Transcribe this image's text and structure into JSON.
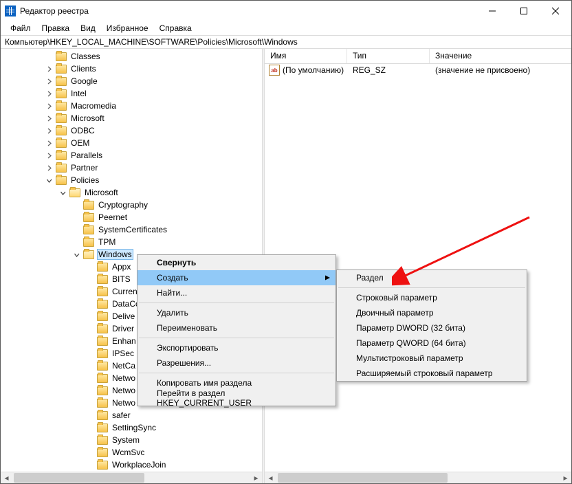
{
  "window": {
    "title": "Редактор реестра"
  },
  "menu": {
    "file": "Файл",
    "edit": "Правка",
    "view": "Вид",
    "fav": "Избранное",
    "help": "Справка"
  },
  "address": "Компьютер\\HKEY_LOCAL_MACHINE\\SOFTWARE\\Policies\\Microsoft\\Windows",
  "tree": {
    "items": [
      {
        "indent": 3,
        "expander": "",
        "label": "Classes"
      },
      {
        "indent": 3,
        "expander": "closed",
        "label": "Clients"
      },
      {
        "indent": 3,
        "expander": "closed",
        "label": "Google"
      },
      {
        "indent": 3,
        "expander": "closed",
        "label": "Intel"
      },
      {
        "indent": 3,
        "expander": "closed",
        "label": "Macromedia"
      },
      {
        "indent": 3,
        "expander": "closed",
        "label": "Microsoft"
      },
      {
        "indent": 3,
        "expander": "closed",
        "label": "ODBC"
      },
      {
        "indent": 3,
        "expander": "closed",
        "label": "OEM"
      },
      {
        "indent": 3,
        "expander": "closed",
        "label": "Parallels"
      },
      {
        "indent": 3,
        "expander": "closed",
        "label": "Partner"
      },
      {
        "indent": 3,
        "expander": "open",
        "label": "Policies"
      },
      {
        "indent": 4,
        "expander": "open",
        "label": "Microsoft",
        "open": true
      },
      {
        "indent": 5,
        "expander": "",
        "label": "Cryptography"
      },
      {
        "indent": 5,
        "expander": "",
        "label": "Peernet"
      },
      {
        "indent": 5,
        "expander": "",
        "label": "SystemCertificates"
      },
      {
        "indent": 5,
        "expander": "",
        "label": "TPM"
      },
      {
        "indent": 5,
        "expander": "open",
        "label": "Windows",
        "open": true,
        "selected": true
      },
      {
        "indent": 6,
        "expander": "",
        "label": "Appx"
      },
      {
        "indent": 6,
        "expander": "",
        "label": "BITS"
      },
      {
        "indent": 6,
        "expander": "",
        "label": "CurrentVersion"
      },
      {
        "indent": 6,
        "expander": "",
        "label": "DataCollection"
      },
      {
        "indent": 6,
        "expander": "",
        "label": "Delive"
      },
      {
        "indent": 6,
        "expander": "",
        "label": "Driver"
      },
      {
        "indent": 6,
        "expander": "",
        "label": "Enhan"
      },
      {
        "indent": 6,
        "expander": "",
        "label": "IPSec"
      },
      {
        "indent": 6,
        "expander": "",
        "label": "NetCa"
      },
      {
        "indent": 6,
        "expander": "",
        "label": "Netwo"
      },
      {
        "indent": 6,
        "expander": "",
        "label": "Netwo"
      },
      {
        "indent": 6,
        "expander": "",
        "label": "Netwo"
      },
      {
        "indent": 6,
        "expander": "",
        "label": "safer"
      },
      {
        "indent": 6,
        "expander": "",
        "label": "SettingSync"
      },
      {
        "indent": 6,
        "expander": "",
        "label": "System"
      },
      {
        "indent": 6,
        "expander": "",
        "label": "WcmSvc"
      },
      {
        "indent": 6,
        "expander": "",
        "label": "WorkplaceJoin"
      }
    ]
  },
  "list": {
    "headers": {
      "name": "Имя",
      "type": "Тип",
      "value": "Значение"
    },
    "rows": [
      {
        "name": "(По умолчанию)",
        "type": "REG_SZ",
        "value": "(значение не присвоено)"
      }
    ]
  },
  "ctx1": {
    "collapse": "Свернуть",
    "create": "Создать",
    "find": "Найти...",
    "delete": "Удалить",
    "rename": "Переименовать",
    "export": "Экспортировать",
    "perm": "Разрешения...",
    "copyname": "Копировать имя раздела",
    "goto": "Перейти в раздел HKEY_CURRENT_USER"
  },
  "ctx2": {
    "key": "Раздел",
    "sz": "Строковый параметр",
    "bin": "Двоичный параметр",
    "dword": "Параметр DWORD (32 бита)",
    "qword": "Параметр QWORD (64 бита)",
    "multi": "Мультистроковый параметр",
    "expand": "Расширяемый строковый параметр"
  }
}
